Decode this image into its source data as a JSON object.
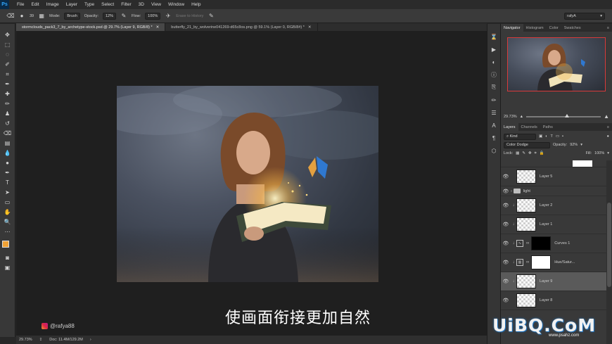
{
  "app": {
    "logo": "Ps"
  },
  "menu": [
    "File",
    "Edit",
    "Image",
    "Layer",
    "Type",
    "Select",
    "Filter",
    "3D",
    "View",
    "Window",
    "Help"
  ],
  "options_bar": {
    "brush_size": "39",
    "mode_label": "Mode:",
    "mode_value": "Brush",
    "opacity_label": "Opacity:",
    "opacity_value": "12%",
    "flow_label": "Flow:",
    "flow_value": "100%",
    "erase_to_history": "Erase to History",
    "workspace": "rafyA"
  },
  "doc_tabs": [
    {
      "label": "stormclouds_pack3_7_by_archetype-stock.psd @ 29.7% (Layer 9, RGB/8) *",
      "active": true
    },
    {
      "label": "butterfly_21_by_wolverine041269-d65c8os.png @ 59.1% (Layer 0, RGB/8#) *",
      "active": false
    }
  ],
  "canvas": {
    "subtitle": "使画面衔接更加自然",
    "handle": "@rafya88"
  },
  "status": {
    "zoom": "29.73%",
    "doc": "Doc: 11.4M/129.2M"
  },
  "navigator": {
    "tabs": [
      "Navigator",
      "Histogram",
      "Color",
      "Swatches"
    ],
    "zoom": "29.73%",
    "zoom_level": 0.55
  },
  "layers_panel": {
    "tabs": [
      "Layers",
      "Channels",
      "Paths"
    ],
    "filter_kind": "Kind",
    "blend_mode": "Color Dodge",
    "opacity_label": "Opacity:",
    "opacity_value": "92%",
    "lock_label": "Lock:",
    "fill_label": "Fill:",
    "fill_value": "100%",
    "layers": [
      {
        "name": "Layer 5",
        "thumb": "check",
        "type": "pixel"
      },
      {
        "name": "light",
        "type": "group"
      },
      {
        "name": "Layer 2",
        "thumb": "check",
        "type": "pixel",
        "clipped": true
      },
      {
        "name": "Layer 1",
        "thumb": "check",
        "type": "pixel",
        "clipped": true
      },
      {
        "name": "Curves 1",
        "thumb": "black",
        "type": "adjustment",
        "clipped": true,
        "icon": "curves-icon"
      },
      {
        "name": "Hue/Satur...",
        "thumb": "white",
        "type": "adjustment",
        "clipped": true,
        "icon": "hue-sat-icon"
      },
      {
        "name": "Layer 9",
        "thumb": "check",
        "type": "pixel",
        "clipped": true,
        "selected": true
      },
      {
        "name": "Layer 8",
        "thumb": "check",
        "type": "pixel"
      }
    ]
  },
  "site": {
    "logo": "UiBQ.CoM",
    "sub": "www.psahz.com"
  },
  "colors": {
    "foreground": "#f0a236",
    "background": "#000000",
    "accent": "#d93a3a"
  }
}
